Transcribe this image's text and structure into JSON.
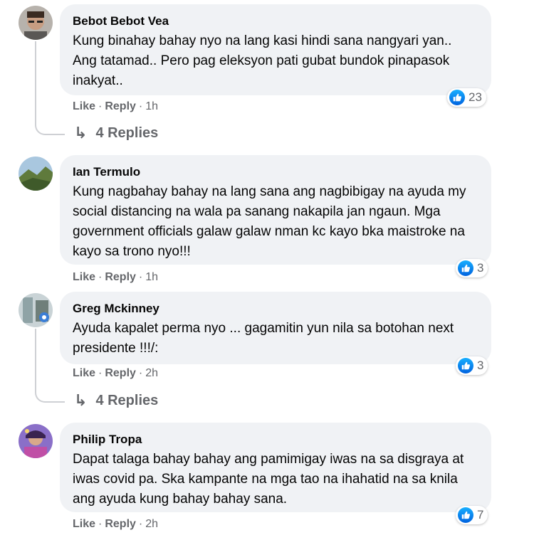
{
  "comments": [
    {
      "author": "Bebot Bebot Vea",
      "text": "Kung binahay bahay nyo na lang kasi hindi sana nangyari yan.. Ang tatamad.. Pero pag eleksyon pati gubat bundok pinapasok inakyat..",
      "like": "Like",
      "reply": "Reply",
      "sep": "·",
      "time": "1h",
      "reactions": "23",
      "replies": "4 Replies"
    },
    {
      "author": "Ian Termulo",
      "text": "Kung nagbahay bahay na lang sana ang nagbibigay na ayuda my social distancing na wala pa sanang nakapila jan ngaun. Mga government officials galaw galaw nman kc kayo bka maistroke na kayo sa trono nyo!!!",
      "like": "Like",
      "reply": "Reply",
      "sep": "·",
      "time": "1h",
      "reactions": "3"
    },
    {
      "author": "Greg Mckinney",
      "text": "Ayuda kapalet perma nyo ... gagamitin yun nila sa botohan next presidente !!!/:",
      "like": "Like",
      "reply": "Reply",
      "sep": "·",
      "time": "2h",
      "reactions": "3",
      "replies": "4 Replies"
    },
    {
      "author": "Philip Tropa",
      "text": "Dapat talaga bahay bahay ang pamimigay iwas na sa disgraya at iwas covid pa. Ska kampante na mga tao na ihahatid na sa knila ang ayuda kung bahay bahay sana.",
      "like": "Like",
      "reply": "Reply",
      "sep": "·",
      "time": "2h",
      "reactions": "7"
    }
  ],
  "colors": {
    "bubble": "#f0f2f5",
    "meta": "#65676b",
    "like_blue": "#1877f2"
  },
  "icons": [
    "like-reaction-icon",
    "reply-arrow-icon",
    "avatar"
  ]
}
